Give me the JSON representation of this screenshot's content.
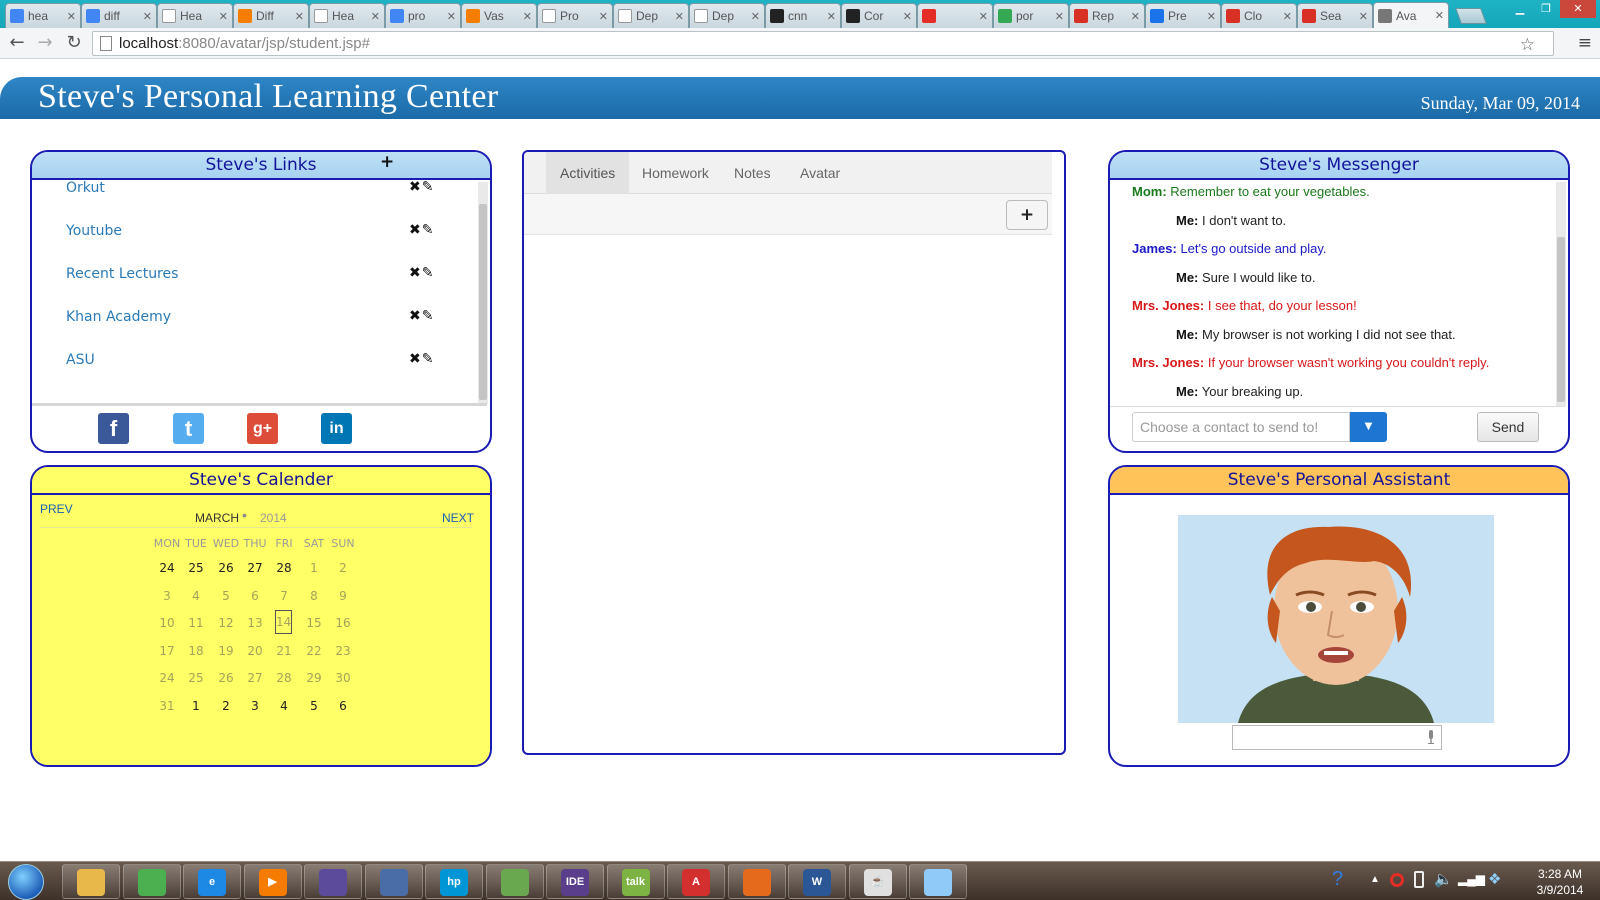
{
  "browser": {
    "tabs": [
      {
        "label": "hea",
        "icon": "google-icon",
        "color": "#4285f4"
      },
      {
        "label": "diff",
        "icon": "google-icon",
        "color": "#4285f4"
      },
      {
        "label": "Hea",
        "icon": "document-icon",
        "color": "#ffffff"
      },
      {
        "label": "Diff",
        "icon": "blogger-icon",
        "color": "#f57d00"
      },
      {
        "label": "Hea",
        "icon": "wikipedia-icon",
        "color": "#ffffff"
      },
      {
        "label": "pro",
        "icon": "google-icon",
        "color": "#4285f4"
      },
      {
        "label": "Vas",
        "icon": "blogger-icon",
        "color": "#f57d00"
      },
      {
        "label": "Pro",
        "icon": "wikipedia-icon",
        "color": "#ffffff"
      },
      {
        "label": "Dep",
        "icon": "document-icon",
        "color": "#ffffff"
      },
      {
        "label": "Dep",
        "icon": "document-icon",
        "color": "#ffffff"
      },
      {
        "label": "cnn",
        "icon": "github-icon",
        "color": "#222222"
      },
      {
        "label": "Cor",
        "icon": "github-icon",
        "color": "#222222"
      },
      {
        "label": "",
        "icon": "youtube-icon",
        "color": "#e52d27"
      },
      {
        "label": "por",
        "icon": "drive-icon",
        "color": "#34a853"
      },
      {
        "label": "Rep",
        "icon": "gmail-icon",
        "color": "#d93025"
      },
      {
        "label": "Pre",
        "icon": "slides-icon",
        "color": "#1a73e8"
      },
      {
        "label": "Clo",
        "icon": "gmail-icon",
        "color": "#d93025"
      },
      {
        "label": "Sea",
        "icon": "gmail-icon",
        "color": "#d93025"
      },
      {
        "label": "Ava",
        "icon": "globe-icon",
        "color": "#777777",
        "active": true
      }
    ],
    "url_host": "localhost",
    "url_path": ":8080/avatar/jsp/student.jsp#"
  },
  "header": {
    "title": "Steve's Personal Learning Center",
    "date": "Sunday, Mar 09, 2014"
  },
  "links_panel": {
    "title": "Steve's Links",
    "add_symbol": "+",
    "items": [
      {
        "label": "Orkut"
      },
      {
        "label": "Youtube"
      },
      {
        "label": "Recent Lectures"
      },
      {
        "label": "Khan Academy"
      },
      {
        "label": "ASU"
      }
    ],
    "social": [
      {
        "name": "facebook",
        "glyph": "f",
        "color": "#3b5998"
      },
      {
        "name": "twitter",
        "glyph": "t",
        "color": "#55acee"
      },
      {
        "name": "google-plus",
        "glyph": "g+",
        "color": "#dd4b39"
      },
      {
        "name": "linkedin",
        "glyph": "in",
        "color": "#0077b5"
      }
    ]
  },
  "calendar": {
    "title": "Steve's Calender",
    "prev_label": "PREV",
    "next_label": "NEXT",
    "month": "MARCH",
    "year": "2014",
    "weekdays": [
      "MON",
      "TUE",
      "WED",
      "THU",
      "FRI",
      "SAT",
      "SUN"
    ],
    "weeks": [
      [
        {
          "d": "24",
          "in": false,
          "bold": true
        },
        {
          "d": "25",
          "in": false,
          "bold": true
        },
        {
          "d": "26",
          "in": false,
          "bold": true
        },
        {
          "d": "27",
          "in": false,
          "bold": true
        },
        {
          "d": "28",
          "in": false,
          "bold": true
        },
        {
          "d": "1",
          "in": true
        },
        {
          "d": "2",
          "in": true
        }
      ],
      [
        {
          "d": "3",
          "in": true
        },
        {
          "d": "4",
          "in": true
        },
        {
          "d": "5",
          "in": true
        },
        {
          "d": "6",
          "in": true
        },
        {
          "d": "7",
          "in": true
        },
        {
          "d": "8",
          "in": true
        },
        {
          "d": "9",
          "in": true
        }
      ],
      [
        {
          "d": "10",
          "in": true
        },
        {
          "d": "11",
          "in": true
        },
        {
          "d": "12",
          "in": true
        },
        {
          "d": "13",
          "in": true
        },
        {
          "d": "14",
          "in": true,
          "today": true
        },
        {
          "d": "15",
          "in": true
        },
        {
          "d": "16",
          "in": true
        }
      ],
      [
        {
          "d": "17",
          "in": true
        },
        {
          "d": "18",
          "in": true
        },
        {
          "d": "19",
          "in": true
        },
        {
          "d": "20",
          "in": true
        },
        {
          "d": "21",
          "in": true
        },
        {
          "d": "22",
          "in": true
        },
        {
          "d": "23",
          "in": true
        }
      ],
      [
        {
          "d": "24",
          "in": true
        },
        {
          "d": "25",
          "in": true
        },
        {
          "d": "26",
          "in": true
        },
        {
          "d": "27",
          "in": true
        },
        {
          "d": "28",
          "in": true
        },
        {
          "d": "29",
          "in": true
        },
        {
          "d": "30",
          "in": true
        }
      ],
      [
        {
          "d": "31",
          "in": true
        },
        {
          "d": "1",
          "in": false,
          "bold": true
        },
        {
          "d": "2",
          "in": false,
          "bold": true
        },
        {
          "d": "3",
          "in": false,
          "bold": true
        },
        {
          "d": "4",
          "in": false,
          "bold": true
        },
        {
          "d": "5",
          "in": false,
          "bold": true
        },
        {
          "d": "6",
          "in": false,
          "bold": true
        }
      ]
    ]
  },
  "center_panel": {
    "tabs": [
      {
        "label": "Activities",
        "active": true
      },
      {
        "label": "Homework"
      },
      {
        "label": "Notes"
      },
      {
        "label": "Avatar"
      }
    ],
    "add_symbol": "+"
  },
  "messenger": {
    "title": "Steve's Messenger",
    "messages": [
      {
        "sender": "Mom:",
        "text": "Remember to eat your vegetables.",
        "color": "#1a7a1a",
        "me": false
      },
      {
        "sender": "Me:",
        "text": "I don't want to.",
        "color": "#111111",
        "me": true
      },
      {
        "sender": "James:",
        "text": "Let's go outside and play.",
        "color": "#1a1ac8",
        "me": false
      },
      {
        "sender": "Me:",
        "text": "Sure I would like to.",
        "color": "#111111",
        "me": true
      },
      {
        "sender": "Mrs. Jones:",
        "text": "I see that, do your lesson!",
        "color": "#d81818",
        "me": false
      },
      {
        "sender": "Me:",
        "text": "My browser is not working I did not see that.",
        "color": "#111111",
        "me": true
      },
      {
        "sender": "Mrs. Jones:",
        "text": "If your browser wasn't working you couldn't reply.",
        "color": "#d81818",
        "me": false
      },
      {
        "sender": "Me:",
        "text": "Your breaking up.",
        "color": "#111111",
        "me": true
      }
    ],
    "contact_placeholder": "Choose a contact to send to!",
    "send_label": "Send"
  },
  "assistant": {
    "title": "Steve's Personal Assistant"
  },
  "taskbar": {
    "apps": [
      {
        "name": "explorer",
        "color": "#e8b84a",
        "glyph": ""
      },
      {
        "name": "chrome",
        "color": "#4caf50",
        "glyph": ""
      },
      {
        "name": "internet-explorer",
        "color": "#1e88e5",
        "glyph": "e"
      },
      {
        "name": "media-player",
        "color": "#f57c00",
        "glyph": "▶"
      },
      {
        "name": "eclipse",
        "color": "#5c4b9a",
        "glyph": ""
      },
      {
        "name": "remote-desktop",
        "color": "#4a6da8",
        "glyph": ""
      },
      {
        "name": "hp",
        "color": "#0096d6",
        "glyph": "hp"
      },
      {
        "name": "chart-app",
        "color": "#6aa84f",
        "glyph": ""
      },
      {
        "name": "java-ee-ide",
        "color": "#5a3e8c",
        "glyph": "IDE"
      },
      {
        "name": "google-talk",
        "color": "#7cb342",
        "glyph": "talk"
      },
      {
        "name": "adobe-reader",
        "color": "#d32f2f",
        "glyph": "A"
      },
      {
        "name": "firefox",
        "color": "#e66a1b",
        "glyph": ""
      },
      {
        "name": "word",
        "color": "#2b5797",
        "glyph": "W"
      },
      {
        "name": "java",
        "color": "#e0e0e0",
        "glyph": "☕"
      },
      {
        "name": "paint",
        "color": "#90caf9",
        "glyph": ""
      }
    ],
    "time": "3:28 AM",
    "date": "3/9/2014"
  }
}
